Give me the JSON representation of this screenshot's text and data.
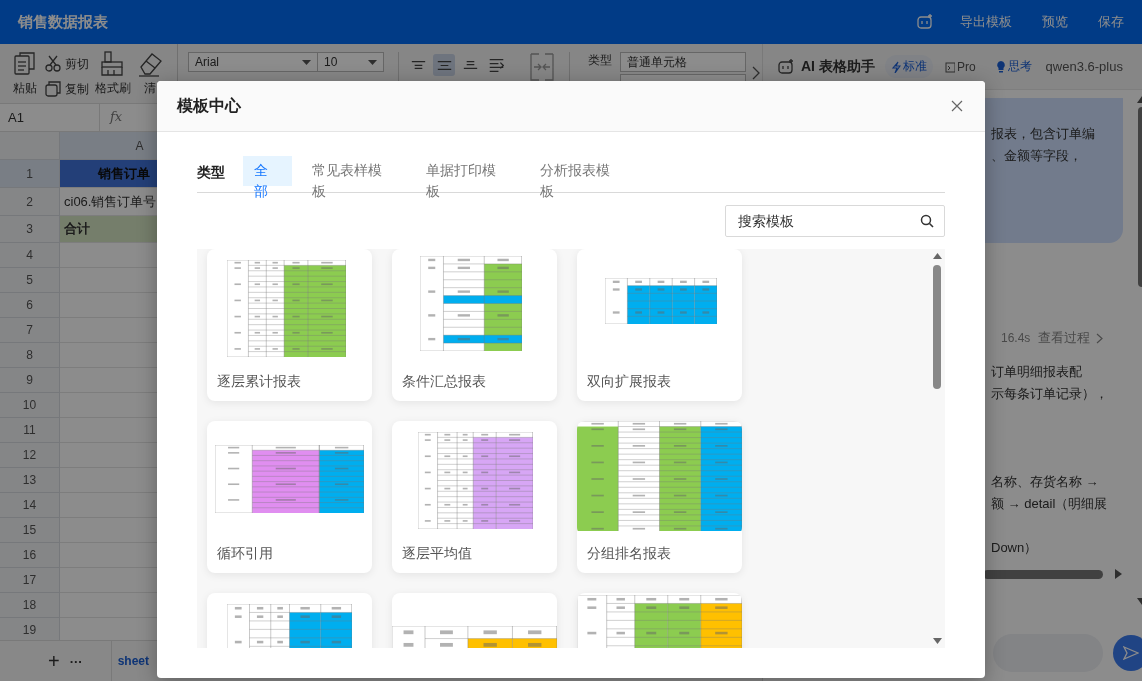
{
  "header": {
    "title": "销售数据报表",
    "actions": [
      "导出模板",
      "预览",
      "保存"
    ]
  },
  "toolbar": {
    "tools": [
      {
        "label": "粘贴",
        "kind": "paste"
      },
      {
        "label": "剪切",
        "kind": "cut"
      },
      {
        "label": "复制",
        "kind": "copy"
      },
      {
        "label": "格式刷",
        "kind": "brush"
      },
      {
        "label": "清",
        "kind": "eraser"
      }
    ],
    "font": {
      "family": "Arial",
      "size": "10"
    },
    "align_buttons": [
      {
        "kind": "top",
        "selected": false
      },
      {
        "kind": "middle",
        "selected": true
      },
      {
        "kind": "bottom",
        "selected": false
      },
      {
        "kind": "wrap",
        "selected": false
      }
    ],
    "cell_type": {
      "label": "类型",
      "value": "普通单元格"
    }
  },
  "ai_bar": {
    "title": "AI 表格助手",
    "modes": [
      {
        "label": "标准",
        "selected": true
      },
      {
        "label": "Pro",
        "selected": false
      }
    ],
    "think": {
      "label": "思考",
      "on": true
    },
    "model": "qwen3.6-plus"
  },
  "formula_bar": {
    "cell_ref": "A1",
    "fx": "fx"
  },
  "sheet": {
    "column_headers": [
      {
        "label": "A",
        "selected": true
      }
    ],
    "rows": [
      {
        "number": "1",
        "cell": "销售订单",
        "kind": "title",
        "selected": true
      },
      {
        "number": "2",
        "cell": "ci06.销售订单号",
        "kind": "field",
        "selected": false
      },
      {
        "number": "3",
        "cell": "合计",
        "kind": "total",
        "selected": false
      },
      {
        "number": "4",
        "selected": false
      },
      {
        "number": "5",
        "selected": false
      },
      {
        "number": "6",
        "selected": false
      },
      {
        "number": "7",
        "selected": false
      },
      {
        "number": "8",
        "selected": false
      },
      {
        "number": "9",
        "selected": false
      },
      {
        "number": "10",
        "selected": false
      },
      {
        "number": "11",
        "selected": false
      },
      {
        "number": "12",
        "selected": false
      },
      {
        "number": "13",
        "selected": false
      },
      {
        "number": "14",
        "selected": false
      },
      {
        "number": "15",
        "selected": false
      },
      {
        "number": "16",
        "selected": false
      },
      {
        "number": "17",
        "selected": false
      },
      {
        "number": "18",
        "selected": false
      },
      {
        "number": "19",
        "selected": false
      }
    ],
    "add": "+",
    "more": "···",
    "sheet_tab": "sheet"
  },
  "chat": {
    "bubble_lines": [
      "报表，包含订单编",
      "、金额等字段，"
    ],
    "duration": "16.4s",
    "view_process": "查看过程",
    "paragraphs": [
      [
        "订单明细报表配",
        "示每条订单记录），"
      ],
      [
        "名称、存货名称 →",
        "额 → detail（明细展"
      ],
      [
        "Down）"
      ]
    ]
  },
  "modal": {
    "title": "模板中心",
    "filter_label": "类型",
    "tabs": [
      {
        "label": "全部",
        "selected": true
      },
      {
        "label": "常见表样模板",
        "selected": false
      },
      {
        "label": "单据打印模板",
        "selected": false
      },
      {
        "label": "分析报表模板",
        "selected": false
      }
    ],
    "search": {
      "placeholder": "搜索模板"
    },
    "templates": [
      {
        "title": "逐层累计报表",
        "kind": "cumulative"
      },
      {
        "title": "条件汇总报表",
        "kind": "summary"
      },
      {
        "title": "双向扩展报表",
        "kind": "cross"
      },
      {
        "title": "循环引用",
        "kind": "loop"
      },
      {
        "title": "逐层平均值",
        "kind": "average"
      },
      {
        "title": "分组排名报表",
        "kind": "ranking"
      },
      {
        "kind": "blue"
      },
      {
        "kind": "orange"
      },
      {
        "kind": "mixed"
      }
    ]
  }
}
